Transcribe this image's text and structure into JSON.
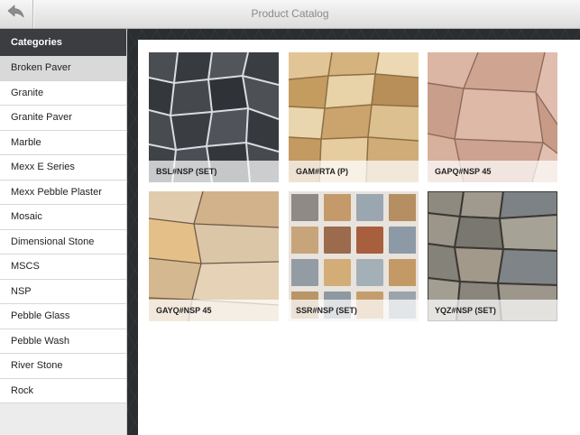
{
  "navbar": {
    "title": "Product Catalog",
    "back_icon": "back-arrow-icon"
  },
  "sidebar": {
    "header": "Categories",
    "selected_index": 0,
    "items": [
      {
        "label": "Broken Paver"
      },
      {
        "label": "Granite"
      },
      {
        "label": "Granite Paver"
      },
      {
        "label": "Marble"
      },
      {
        "label": "Mexx E Series"
      },
      {
        "label": "Mexx Pebble Plaster"
      },
      {
        "label": "Mosaic"
      },
      {
        "label": "Dimensional Stone"
      },
      {
        "label": "MSCS"
      },
      {
        "label": "NSP"
      },
      {
        "label": "Pebble Glass"
      },
      {
        "label": "Pebble Wash"
      },
      {
        "label": "River Stone"
      },
      {
        "label": "Rock"
      }
    ]
  },
  "products": [
    {
      "label": "BSL#NSP (SET)",
      "base": "#3e4247",
      "grout": "#d9dde2"
    },
    {
      "label": "GAM#RTA (P)",
      "base": "#d1b07a",
      "grout": "#8f6f42"
    },
    {
      "label": "GAPQ#NSP 45",
      "base": "#d9b19f",
      "grout": "#8c6b5d"
    },
    {
      "label": "GAYQ#NSP 45",
      "base": "#d9c0a0",
      "grout": "#6e5a48"
    },
    {
      "label": "SSR#NSP (SET)",
      "base": "#9c8d84",
      "grout": "#e8e3dc"
    },
    {
      "label": "YQZ#NSP (SET)",
      "base": "#8b867c",
      "grout": "#3b3833"
    }
  ]
}
